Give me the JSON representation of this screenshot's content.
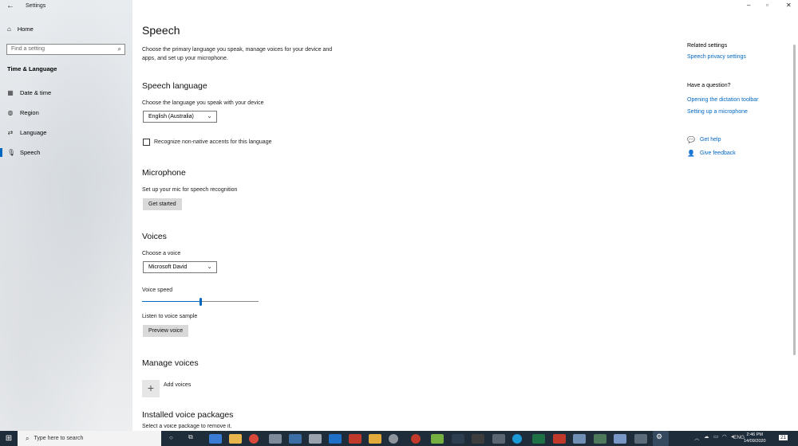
{
  "window": {
    "title": "Settings",
    "controls": {
      "minimize": "–",
      "restore": "▫",
      "close": "✕"
    }
  },
  "sidebar": {
    "home_label": "Home",
    "search_placeholder": "Find a setting",
    "group_title": "Time & Language",
    "items": [
      {
        "label": "Date & time",
        "icon": "calendar-clock-icon"
      },
      {
        "label": "Region",
        "icon": "globe-icon"
      },
      {
        "label": "Language",
        "icon": "language-icon"
      },
      {
        "label": "Speech",
        "icon": "microphone-icon",
        "selected": true
      }
    ]
  },
  "main": {
    "title": "Speech",
    "description": "Choose the primary language you speak, manage voices for your device and apps, and set up your microphone.",
    "speech_language": {
      "heading": "Speech language",
      "label": "Choose the language you speak with your device",
      "selected": "English (Australia)",
      "checkbox_label": "Recognize non-native accents for this language",
      "checkbox_checked": false
    },
    "microphone": {
      "heading": "Microphone",
      "label": "Set up your mic for speech recognition",
      "button": "Get started"
    },
    "voices": {
      "heading": "Voices",
      "choose_label": "Choose a voice",
      "selected_voice": "Microsoft David",
      "speed_label": "Voice speed",
      "speed_fraction": 0.5,
      "sample_label": "Listen to voice sample",
      "preview_button": "Preview voice"
    },
    "manage_voices": {
      "heading": "Manage voices",
      "add_label": "Add voices"
    },
    "installed": {
      "heading": "Installed voice packages",
      "hint": "Select a voice package to remove it."
    }
  },
  "right": {
    "related_title": "Related settings",
    "related_link": "Speech privacy settings",
    "question_title": "Have a question?",
    "question_links": [
      "Opening the dictation toolbar",
      "Setting up a microphone"
    ],
    "get_help": "Get help",
    "give_feedback": "Give feedback"
  },
  "taskbar": {
    "search_placeholder": "Type here to search",
    "language": "ENG",
    "time": "2:46 PM",
    "date": "14/09/2020",
    "notification_count": "21",
    "colors": {
      "background": "#1f2c3a",
      "accent": "#0067c0"
    }
  }
}
